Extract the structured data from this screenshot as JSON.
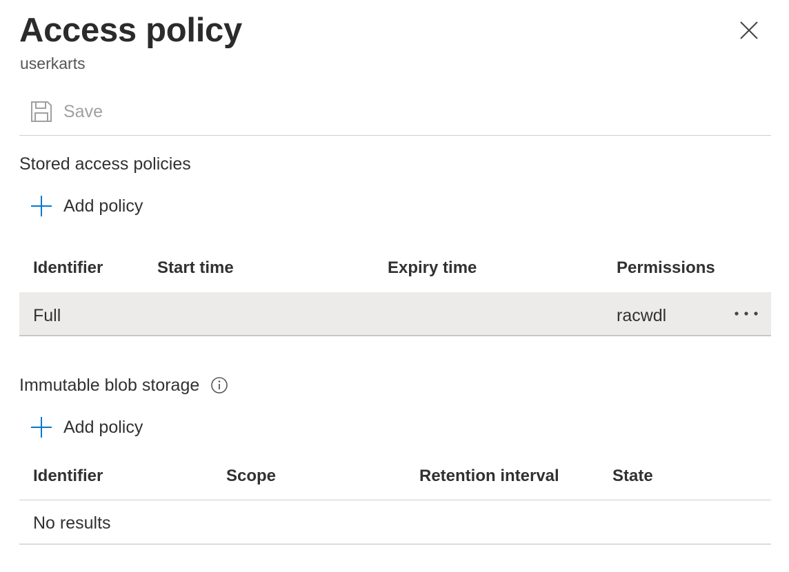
{
  "header": {
    "title": "Access policy",
    "subtitle": "userkarts"
  },
  "toolbar": {
    "save_label": "Save",
    "save_icon": "floppy-disk-icon"
  },
  "stored_policies": {
    "section_title": "Stored access policies",
    "add_label": "Add policy",
    "columns": [
      "Identifier",
      "Start time",
      "Expiry time",
      "Permissions"
    ],
    "rows": [
      {
        "identifier": "Full",
        "start_time": "",
        "expiry_time": "",
        "permissions": "racwdl"
      }
    ]
  },
  "immutable_storage": {
    "section_title": "Immutable blob storage",
    "add_label": "Add policy",
    "columns": [
      "Identifier",
      "Scope",
      "Retention interval",
      "State"
    ],
    "empty_text": "No results"
  },
  "colors": {
    "accent": "#0078d4",
    "selected_row": "#edebe9",
    "disabled_text": "#a19f9d"
  }
}
